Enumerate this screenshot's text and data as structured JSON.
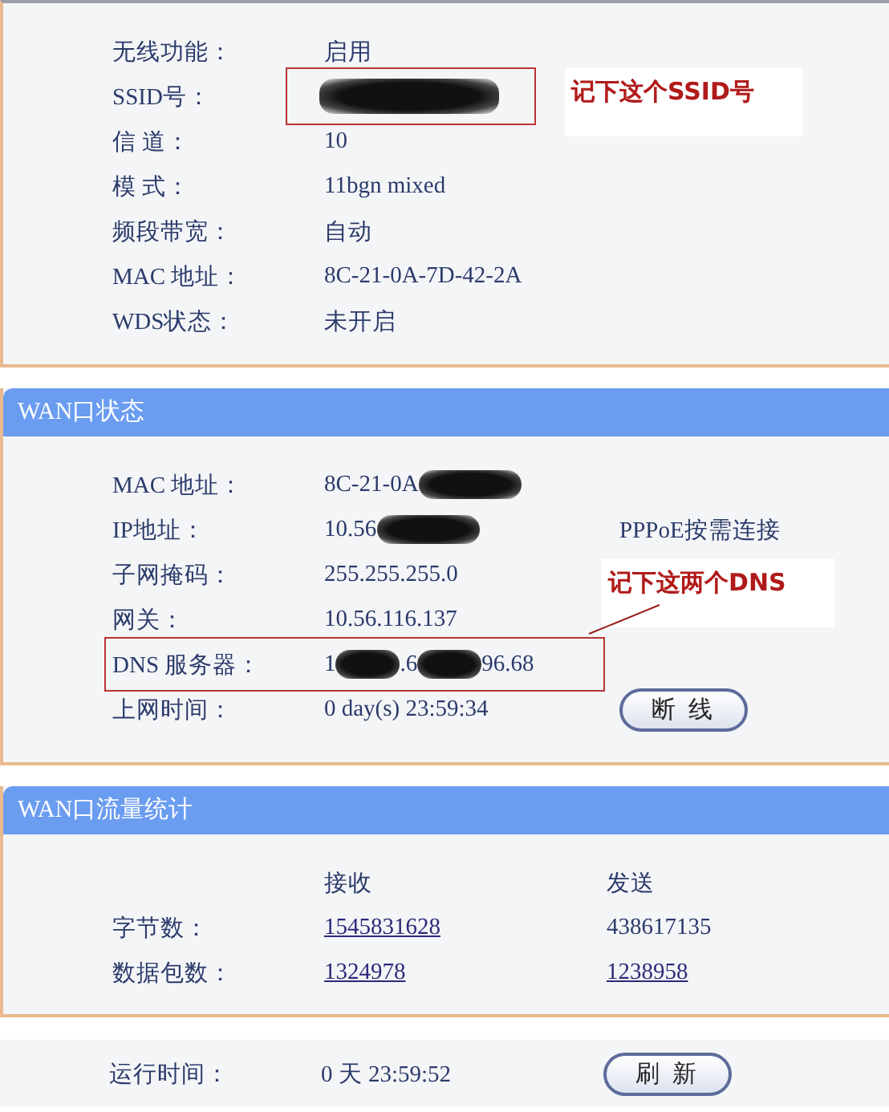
{
  "wireless": {
    "annotation": "记下这个SSID号",
    "rows": [
      {
        "label": "无线功能：",
        "value": [
          {
            "kind": "text",
            "text": "启用"
          }
        ]
      },
      {
        "label": "SSID号：",
        "value_boxed": true,
        "value": [
          {
            "kind": "redaction"
          }
        ]
      },
      {
        "label": "信 道：",
        "value": [
          {
            "kind": "text",
            "text": "10"
          }
        ]
      },
      {
        "label": "模 式：",
        "value": [
          {
            "kind": "text",
            "text": "11bgn mixed"
          }
        ]
      },
      {
        "label": "频段带宽：",
        "value": [
          {
            "kind": "text",
            "text": "自动"
          }
        ]
      },
      {
        "label": "MAC 地址：",
        "value": [
          {
            "kind": "text",
            "text": "8C-21-0A-7D-42-2A"
          }
        ]
      },
      {
        "label": "WDS状态：",
        "value": [
          {
            "kind": "text",
            "text": "未开启"
          }
        ]
      }
    ]
  },
  "wan_status": {
    "title": "WAN口状态",
    "annotation": "记下这两个DNS",
    "rows": [
      {
        "label": "MAC 地址：",
        "value": [
          {
            "kind": "text",
            "text": "8C-21-0A"
          },
          {
            "kind": "redaction"
          }
        ]
      },
      {
        "label": "IP地址：",
        "value": [
          {
            "kind": "text",
            "text": "10.56"
          },
          {
            "kind": "redaction"
          }
        ],
        "extra": {
          "kind": "text",
          "text": "PPPoE按需连接"
        }
      },
      {
        "label": "子网掩码：",
        "value": [
          {
            "kind": "text",
            "text": "255.255.255.0"
          }
        ]
      },
      {
        "label": "网关：",
        "value": [
          {
            "kind": "text",
            "text": "10.56.116.137"
          }
        ]
      },
      {
        "label": "DNS 服务器：",
        "row_boxed": true,
        "value": [
          {
            "kind": "text",
            "text": "1"
          },
          {
            "kind": "redaction"
          },
          {
            "kind": "text",
            "text": ".6"
          },
          {
            "kind": "redaction"
          },
          {
            "kind": "text",
            "text": "96.68"
          }
        ]
      },
      {
        "label": "上网时间：",
        "value": [
          {
            "kind": "text",
            "text": "0 day(s) 23:59:34"
          }
        ],
        "extra": {
          "kind": "button",
          "text": "断 线"
        }
      }
    ]
  },
  "wan_traffic": {
    "title": "WAN口流量统计",
    "columns": [
      "接收",
      "发送"
    ],
    "rows": [
      {
        "label": "字节数：",
        "cells": [
          {
            "text": "1545831628",
            "link": true
          },
          {
            "text": "438617135",
            "link": false
          }
        ]
      },
      {
        "label": "数据包数：",
        "cells": [
          {
            "text": "1324978",
            "link": true
          },
          {
            "text": "1238958",
            "link": true
          }
        ]
      }
    ]
  },
  "uptime": {
    "label": "运行时间：",
    "value": "0 天 23:59:52",
    "button": "刷 新"
  }
}
